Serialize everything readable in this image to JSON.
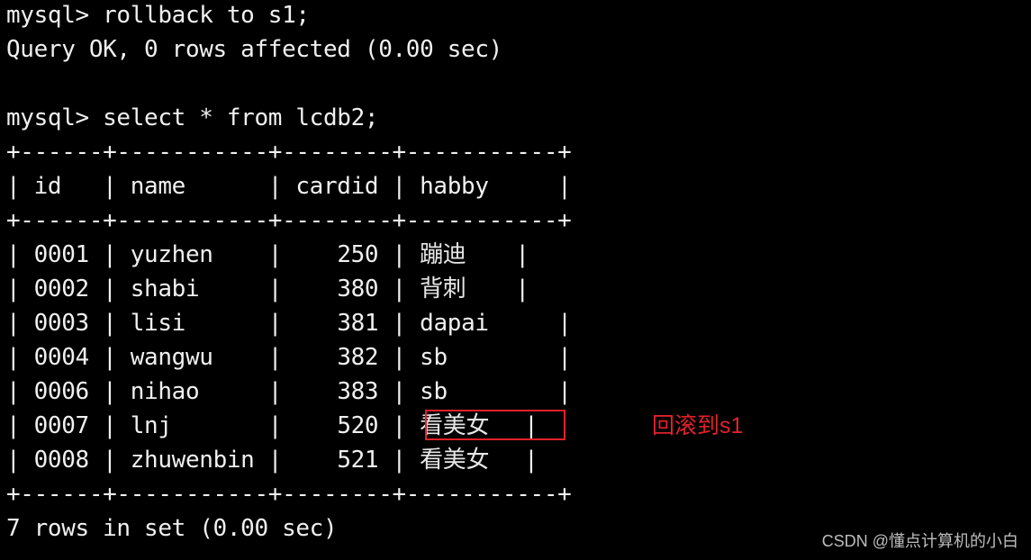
{
  "terminal": {
    "prompt": "mysql> ",
    "commands": [
      {
        "command": "rollback to s1;",
        "response": "Query OK, 0 rows affected (0.00 sec)"
      },
      {
        "command": "select * from lcdb2;"
      }
    ],
    "table": {
      "border": "+------+-----------+--------+-----------+",
      "header": "| id   | name      | cardid | habby     |",
      "columns": [
        "id",
        "name",
        "cardid",
        "habby"
      ],
      "rows": [
        {
          "id": "0001",
          "name": "yuzhen",
          "cardid": "250",
          "habby": "蹦迪"
        },
        {
          "id": "0002",
          "name": "shabi",
          "cardid": "380",
          "habby": "背刺"
        },
        {
          "id": "0003",
          "name": "lisi",
          "cardid": "381",
          "habby": "dapai"
        },
        {
          "id": "0004",
          "name": "wangwu",
          "cardid": "382",
          "habby": "sb"
        },
        {
          "id": "0006",
          "name": "nihao",
          "cardid": "383",
          "habby": "sb"
        },
        {
          "id": "0007",
          "name": "lnj",
          "cardid": "520",
          "habby": "看美女"
        },
        {
          "id": "0008",
          "name": "zhuwenbin",
          "cardid": "521",
          "habby": "看美女"
        }
      ]
    },
    "summary": "7 rows in set (0.00 sec)"
  },
  "annotation": {
    "text": "回滚到s1",
    "color": "#e0212b",
    "highlighted_row_index": 5
  },
  "watermark": "CSDN @懂点计算机的小白"
}
